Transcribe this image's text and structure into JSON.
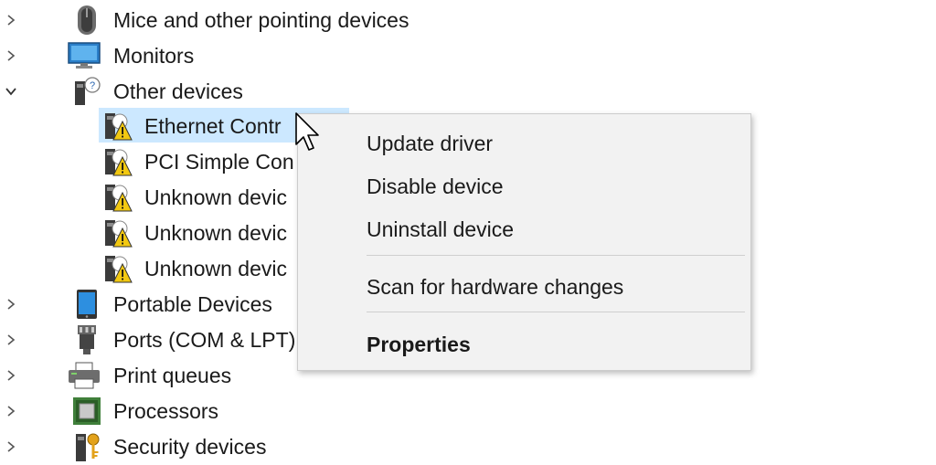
{
  "tree": {
    "items": [
      {
        "label": "Mice and other pointing devices",
        "icon": "mouse-icon"
      },
      {
        "label": "Monitors",
        "icon": "monitor-icon"
      },
      {
        "label": "Other devices",
        "icon": "unknown-device-icon",
        "expanded": true
      },
      {
        "label": "Ethernet Contr",
        "icon": "warning-device-icon",
        "child": true
      },
      {
        "label": "PCI Simple Con",
        "icon": "warning-device-icon",
        "child": true
      },
      {
        "label": "Unknown devic",
        "icon": "warning-device-icon",
        "child": true
      },
      {
        "label": "Unknown devic",
        "icon": "warning-device-icon",
        "child": true
      },
      {
        "label": "Unknown devic",
        "icon": "warning-device-icon",
        "child": true
      },
      {
        "label": "Portable Devices",
        "icon": "portable-device-icon"
      },
      {
        "label": "Ports (COM & LPT)",
        "icon": "port-icon"
      },
      {
        "label": "Print queues",
        "icon": "printer-icon"
      },
      {
        "label": "Processors",
        "icon": "processor-icon"
      },
      {
        "label": "Security devices",
        "icon": "security-device-icon"
      }
    ]
  },
  "context_menu": {
    "update_driver": "Update driver",
    "disable_device": "Disable device",
    "uninstall_device": "Uninstall device",
    "scan_hardware": "Scan for hardware changes",
    "properties": "Properties"
  },
  "colors": {
    "selection": "#cce8ff",
    "menu_bg": "#f2f2f2",
    "warning": "#f2c811"
  }
}
